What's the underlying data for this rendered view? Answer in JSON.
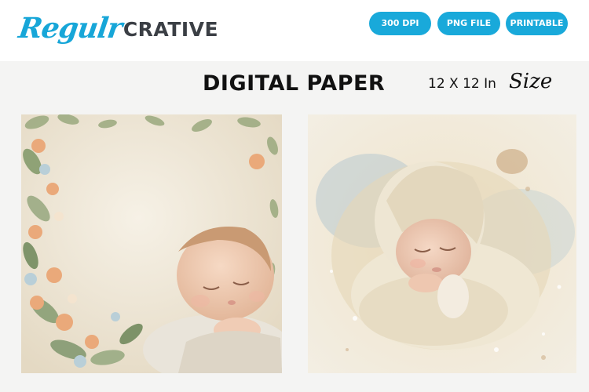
{
  "brand": {
    "script": "Regulr",
    "block": "CRATIVE"
  },
  "badges": {
    "dpi": "300 DPI",
    "png": "PNG FILE",
    "printable": "PRINTABLE"
  },
  "headline": {
    "title": "DIGITAL PAPER",
    "size": "12 X 12 In",
    "size_word": "Size"
  },
  "colors": {
    "accent": "#19a9da",
    "brand_dark": "#3b3f45",
    "band": "#f4f4f3"
  },
  "previews": [
    {
      "subject": "sleeping baby with floral watercolor border"
    },
    {
      "subject": "newborn in knit bonnet wrapped in blanket, watercolor splash"
    }
  ]
}
